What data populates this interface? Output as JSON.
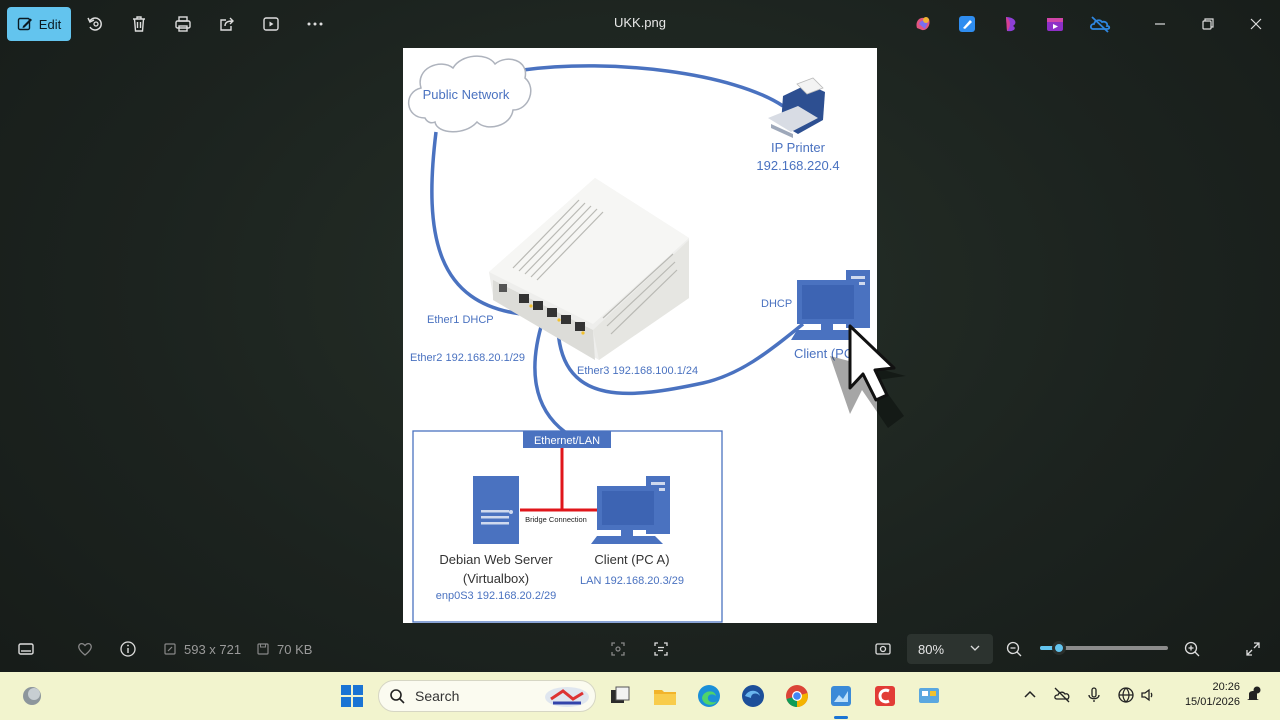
{
  "toolbar": {
    "edit_label": "Edit",
    "file_title": "UKK.png",
    "icons": [
      "edit-icon",
      "rotate-icon",
      "delete-icon",
      "print-icon",
      "share-icon",
      "slideshow-icon",
      "more-icon"
    ],
    "app_icons": [
      "copilot-icon",
      "designer-icon",
      "clipchamp-icon",
      "video-editor-icon",
      "onedrive-icon"
    ],
    "window_controls": [
      "minimize-icon",
      "restore-icon",
      "close-icon"
    ]
  },
  "image": {
    "cloud_label": "Public Network",
    "printer_label": "IP Printer",
    "printer_ip": "192.168.220.4",
    "ether1_label": "Ether1 DHCP",
    "ether2_label": "Ether2 192.168.20.1/29",
    "ether3_label": "Ether3 192.168.100.1/24",
    "dhcp_label": "DHCP",
    "client_right_label": "Client (PC",
    "lan_box_label": "Ethernet/LAN",
    "bridge_label": "Bridge Connection",
    "server_label_1": "Debian Web Server",
    "server_label_2": "(Virtualbox)",
    "server_ip": "enp0S3 192.168.20.2/29",
    "client_a_label": "Client (PC A)",
    "client_a_ip": "LAN 192.168.20.3/29"
  },
  "bottombar": {
    "dimensions": "593 x 721",
    "file_size": "70 KB",
    "zoom_value": "80%",
    "zoom_fraction": 0.15
  },
  "taskbar": {
    "search_placeholder": "Search",
    "time": "20:26",
    "date": "15/01/2026"
  },
  "colors": {
    "accent": "#63c4ee",
    "diagram_blue": "#4a72c0",
    "bridge_red": "#e0161b",
    "taskbar_bg": "#f2f4ce"
  }
}
